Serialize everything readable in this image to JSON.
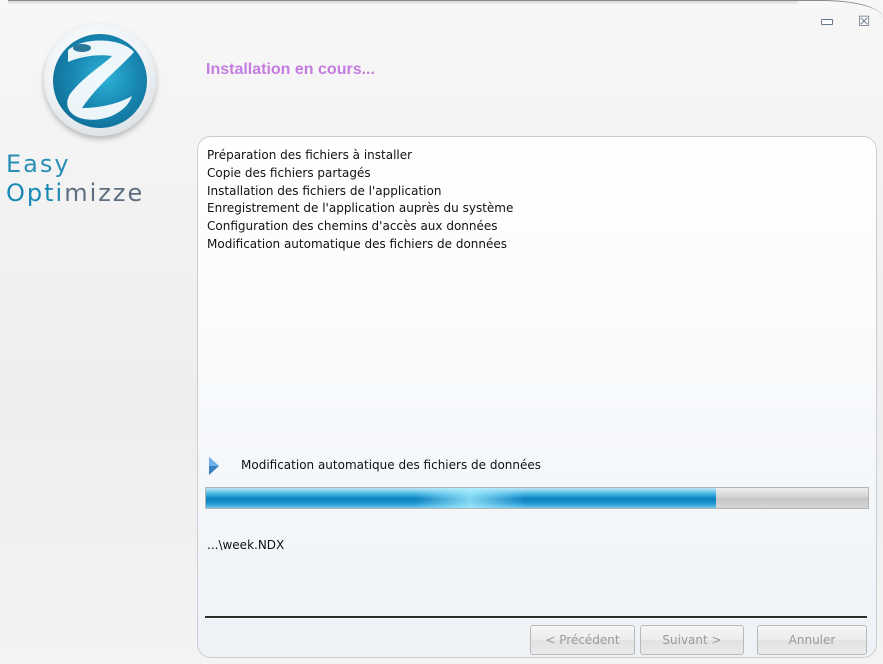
{
  "window": {
    "controls": {
      "minimize_icon": "minimize-icon",
      "close_icon": "close-icon",
      "close_glyph": "☒"
    }
  },
  "brand": {
    "line1": "Easy",
    "line2_a": "Opti",
    "line2_b": "mizze",
    "colors": {
      "primary": "#1b89b5",
      "secondary": "#5d6f80"
    }
  },
  "header": {
    "title": "Installation en cours...",
    "title_color": "#c57be0"
  },
  "steps": [
    "Préparation des fichiers à installer",
    "Copie des fichiers partagés",
    "Installation des fichiers de l'application",
    "Enregistrement de l'application auprès du système",
    "Configuration des chemins d'accès aux données",
    "Modification automatique des fichiers de données"
  ],
  "current": {
    "label": "Modification automatique des fichiers de données",
    "progress": 0.77
  },
  "file": "...\\week.NDX",
  "buttons": {
    "prev": "< Précédent",
    "next": "Suivant >",
    "cancel": "Annuler"
  }
}
